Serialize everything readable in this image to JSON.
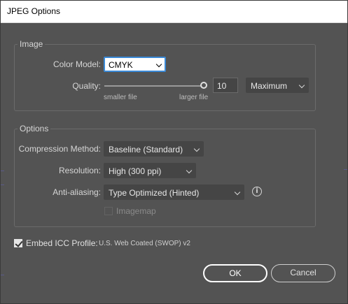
{
  "window": {
    "title": "JPEG Options"
  },
  "image_group": {
    "label": "Image",
    "color_model": {
      "label": "Color Model:",
      "value": "CMYK"
    },
    "quality": {
      "label": "Quality:",
      "level": 10,
      "slider_fraction": 1.0,
      "min_label": "smaller file",
      "max_label": "larger file",
      "preset": "Maximum"
    }
  },
  "options_group": {
    "label": "Options",
    "compression": {
      "label": "Compression Method:",
      "value": "Baseline (Standard)"
    },
    "resolution": {
      "label": "Resolution:",
      "value": "High (300 ppi)"
    },
    "anti_aliasing": {
      "label": "Anti-aliasing:",
      "value": "Type Optimized (Hinted)",
      "info_icon": "info-icon"
    },
    "imagemap": {
      "label": "Imagemap",
      "checked": false,
      "enabled": false
    }
  },
  "icc": {
    "label": "Embed ICC Profile:",
    "profile": "U.S. Web Coated (SWOP) v2",
    "checked": true
  },
  "buttons": {
    "ok": "OK",
    "cancel": "Cancel"
  },
  "colors": {
    "dialog_bg": "#535353",
    "focus_ring": "#3b8ad8",
    "text": "#d6d6d6"
  }
}
